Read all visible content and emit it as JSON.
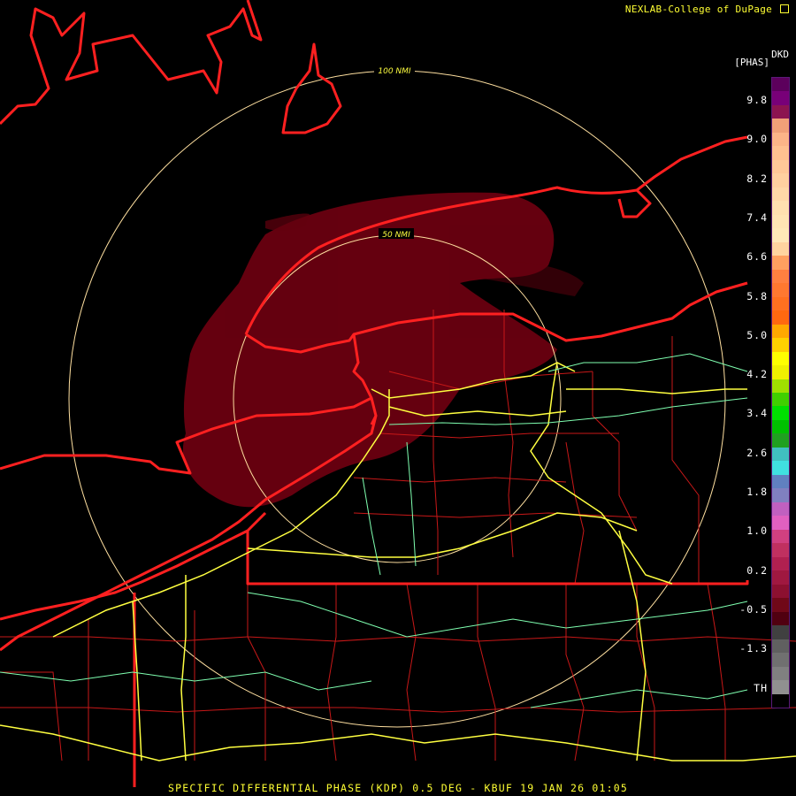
{
  "credit": "NEXLAB-College of DuPage",
  "credit_icon": "external-link-icon",
  "footer": "SPECIFIC DIFFERENTIAL PHASE (KDP) 0.5 DEG - KBUF 19 JAN 26 01:05",
  "product_code": "DKD",
  "units": "[PHAS]",
  "range_rings": [
    {
      "label": "100 NMI"
    },
    {
      "label": "50 NMI"
    }
  ],
  "colorbar": {
    "ticks": [
      "9.8",
      "9.0",
      "8.2",
      "7.4",
      "6.6",
      "5.8",
      "5.0",
      "4.2",
      "3.4",
      "2.6",
      "1.8",
      "1.0",
      "0.2",
      "-0.5",
      "-1.3",
      "TH"
    ],
    "colors": [
      "#5c005c",
      "#780078",
      "#8c1450",
      "#f0a078",
      "#fcb488",
      "#ffc090",
      "#ffc898",
      "#ffd0a0",
      "#ffd8a8",
      "#ffe0b0",
      "#ffe4b4",
      "#ffe8b8",
      "#ffd4a0",
      "#ffa060",
      "#ff8040",
      "#ff7830",
      "#ff7020",
      "#ff6810",
      "#ffa800",
      "#ffd000",
      "#ffff00",
      "#f0f000",
      "#a0e000",
      "#40d000",
      "#00e000",
      "#00c000",
      "#20a020",
      "#40c0c0",
      "#40e0e0",
      "#6080c0",
      "#8080c0",
      "#c060c0",
      "#e060c0",
      "#d04080",
      "#c03060",
      "#b02050",
      "#a01840",
      "#8c1030",
      "#700818",
      "#500010",
      "#404040",
      "#606060",
      "#707070",
      "#808080",
      "#909090",
      "#000000"
    ]
  },
  "colors": {
    "coastline": "#ff2020",
    "county": "#c81818",
    "highway": "#ffff40",
    "road": "#7fffb0",
    "ring": "#ffe0a0",
    "echo": "#6a0010"
  }
}
